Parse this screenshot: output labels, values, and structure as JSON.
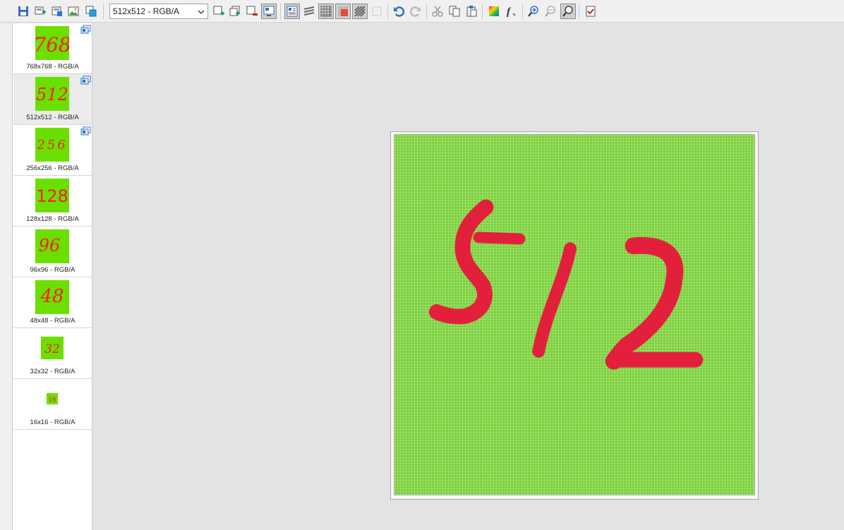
{
  "toolbar": {
    "size_select_value": "512x512 - RGB/A",
    "buttons": [
      "save",
      "new-image",
      "add-image",
      "import-image",
      "create-icons",
      "add-frame",
      "duplicate-frame",
      "remove-frame",
      "frame-properties",
      "preview",
      "layers",
      "grid",
      "background",
      "transparency",
      "select",
      "undo",
      "redo",
      "cut",
      "copy",
      "paste",
      "color-picker",
      "effects",
      "zoom-in",
      "zoom-out",
      "zoom-fit",
      "validate"
    ]
  },
  "frames": [
    {
      "label": "768x768 - RGB/A",
      "digits": "768",
      "selected": false,
      "badge": true
    },
    {
      "label": "512x512 - RGB/A",
      "digits": "512",
      "selected": true,
      "badge": true
    },
    {
      "label": "256x256 - RGB/A",
      "digits": "256",
      "selected": false,
      "badge": true
    },
    {
      "label": "128x128 - RGB/A",
      "digits": "128",
      "selected": false,
      "badge": false
    },
    {
      "label": "96x96 - RGB/A",
      "digits": "96",
      "selected": false,
      "badge": false
    },
    {
      "label": "48x48 - RGB/A",
      "digits": "48",
      "selected": false,
      "badge": false
    },
    {
      "label": "32x32 - RGB/A",
      "digits": "32",
      "selected": false,
      "badge": false
    },
    {
      "label": "16x16 - RGB/A",
      "digits": "16",
      "selected": false,
      "badge": false
    }
  ],
  "canvas": {
    "digits": "512",
    "background_color": "#7cd13c",
    "stroke_color": "#e3203c"
  },
  "colors": {
    "accent": "#2f6fc3",
    "thumb_green": "#6be000",
    "digit_red": "#ff1a1a"
  }
}
